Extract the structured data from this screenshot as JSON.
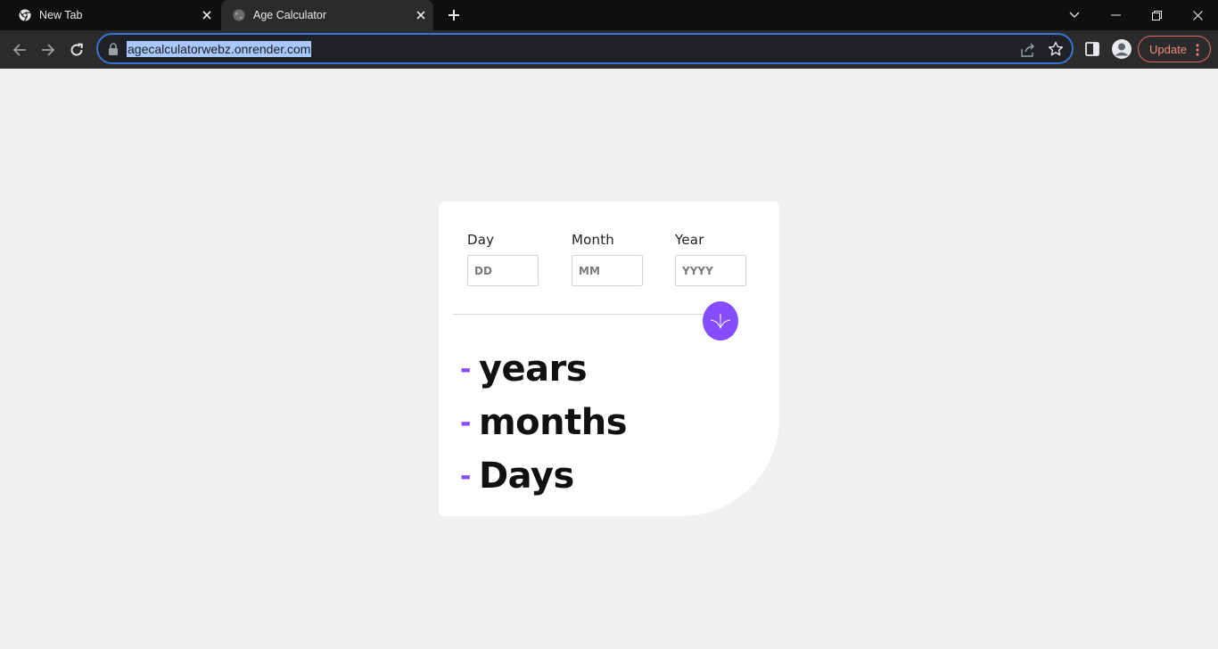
{
  "browser": {
    "tabs": [
      {
        "title": "New Tab",
        "active": false,
        "icon": "chrome-icon"
      },
      {
        "title": "Age Calculator",
        "active": true,
        "icon": "globe-icon"
      }
    ],
    "address": "agecalculatorwebz.onrender.com",
    "update_label": "Update",
    "colors": {
      "focus": "#3b73d6",
      "update": "#f28b82"
    }
  },
  "form": {
    "day": {
      "label": "Day",
      "placeholder": "DD",
      "value": ""
    },
    "month": {
      "label": "Month",
      "placeholder": "MM",
      "value": ""
    },
    "year": {
      "label": "Year",
      "placeholder": "YYYY",
      "value": ""
    },
    "submit_icon": "arrow-down-icon"
  },
  "results": {
    "years": {
      "value": "-",
      "unit": "years"
    },
    "months": {
      "value": "-",
      "unit": "months"
    },
    "days": {
      "value": "-",
      "unit": "Days"
    }
  },
  "colors": {
    "accent": "#854dff",
    "background": "#f0f0f0",
    "card": "#ffffff"
  }
}
